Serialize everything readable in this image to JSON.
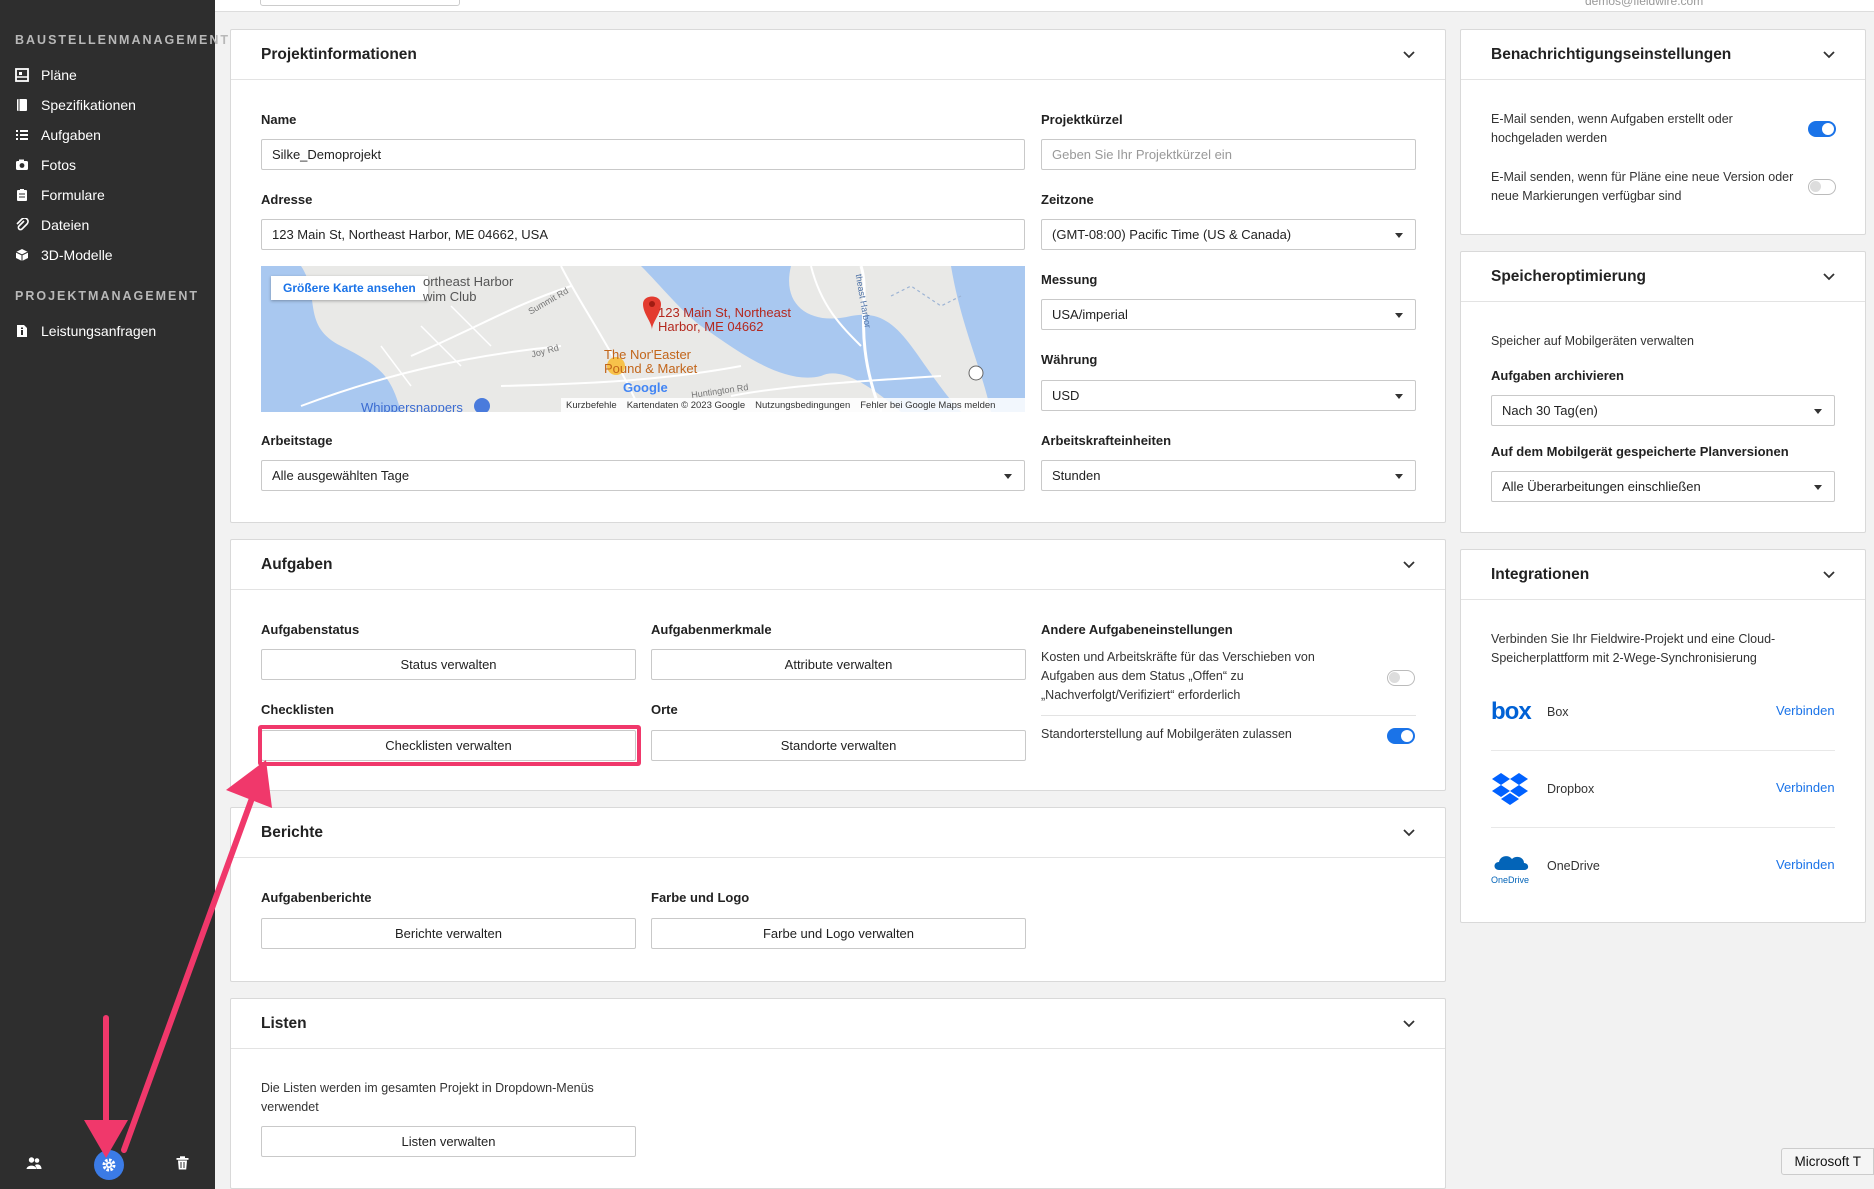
{
  "sidebar": {
    "section1": "BAUSTELLENMANAGEMENT",
    "items1": [
      "Pläne",
      "Spezifikationen",
      "Aufgaben",
      "Fotos",
      "Formulare",
      "Dateien",
      "3D-Modelle"
    ],
    "section2": "PROJEKTMANAGEMENT",
    "items2": [
      "Leistungsanfragen"
    ]
  },
  "topbar": {
    "email": "demos@fieldwire.com"
  },
  "projekt": {
    "title": "Projektinformationen",
    "name_label": "Name",
    "name_value": "Silke_Demoprojekt",
    "kuerzel_label": "Projektkürzel",
    "kuerzel_placeholder": "Geben Sie Ihr Projektkürzel ein",
    "adresse_label": "Adresse",
    "adresse_value": "123 Main St, Northeast Harbor, ME 04662, USA",
    "zeitzone_label": "Zeitzone",
    "zeitzone_value": "(GMT-08:00) Pacific Time (US & Canada)",
    "messung_label": "Messung",
    "messung_value": "USA/imperial",
    "waehrung_label": "Währung",
    "waehrung_value": "USD",
    "arbeitstage_label": "Arbeitstage",
    "arbeitstage_value": "Alle ausgewählten Tage",
    "arbeitskraft_label": "Arbeitskrafteinheiten",
    "arbeitskraft_value": "Stunden"
  },
  "map": {
    "button": "Größere Karte ansehen",
    "pin_label_1": "123 Main St, Northeast",
    "pin_label_2": "Harbor, ME 04662",
    "poi_1": "The Nor'Easter",
    "poi_2": "Pound & Market",
    "place_1": "ortheast Harbor",
    "place_2": "wim Club",
    "place_3": "Whippersnappers",
    "road_1": "Summit Rd",
    "road_2": "Joy Rd",
    "road_3": "Huntington Rd",
    "water_label": "theast Harbor",
    "brand": "Google",
    "footer": [
      "Kurzbefehle",
      "Kartendaten © 2023 Google",
      "Nutzungsbedingungen",
      "Fehler bei Google Maps melden"
    ]
  },
  "aufgaben": {
    "title": "Aufgaben",
    "status_label": "Aufgabenstatus",
    "status_btn": "Status verwalten",
    "merkmale_label": "Aufgabenmerkmale",
    "merkmale_btn": "Attribute verwalten",
    "andere_label": "Andere Aufgabeneinstellungen",
    "andere_text": "Kosten und Arbeitskräfte für das Verschieben von Aufgaben aus dem Status „Offen“ zu „Nachverfolgt/Verifiziert“ erforderlich",
    "mobile_text": "Standorterstellung auf Mobilgeräten zulassen",
    "checklisten_label": "Checklisten",
    "checklisten_btn": "Checklisten verwalten",
    "orte_label": "Orte",
    "orte_btn": "Standorte verwalten"
  },
  "berichte": {
    "title": "Berichte",
    "aufgabenberichte_label": "Aufgabenberichte",
    "berichte_btn": "Berichte verwalten",
    "farbe_label": "Farbe und Logo",
    "farbe_btn": "Farbe und Logo verwalten"
  },
  "listen": {
    "title": "Listen",
    "text": "Die Listen werden im gesamten Projekt in Dropdown-Menüs verwendet",
    "btn": "Listen verwalten"
  },
  "benachrichtigung": {
    "title": "Benachrichtigungseinstellungen",
    "item1": "E-Mail senden, wenn Aufgaben erstellt oder hochgeladen werden",
    "item2": "E-Mail senden, wenn für Pläne eine neue Version oder neue Markierungen verfügbar sind"
  },
  "speicher": {
    "title": "Speicheroptimierung",
    "text": "Speicher auf Mobilgeräten verwalten",
    "archiv_label": "Aufgaben archivieren",
    "archiv_value": "Nach 30 Tag(en)",
    "plan_label": "Auf dem Mobilgerät gespeicherte Planversionen",
    "plan_value": "Alle Überarbeitungen einschließen"
  },
  "integrationen": {
    "title": "Integrationen",
    "text": "Verbinden Sie Ihr Fieldwire-Projekt und eine Cloud-Speicherplattform mit 2-Wege-Synchronisierung",
    "box_logo": "box",
    "onedrive_logo": "OneDrive",
    "items": [
      {
        "name": "Box",
        "action": "Verbinden"
      },
      {
        "name": "Dropbox",
        "action": "Verbinden"
      },
      {
        "name": "OneDrive",
        "action": "Verbinden"
      }
    ]
  },
  "tooltip": "Microsoft T",
  "colors": {
    "accent": "#1a73e8",
    "highlight": "#f0386b",
    "sidebar": "#2e2e2e"
  }
}
